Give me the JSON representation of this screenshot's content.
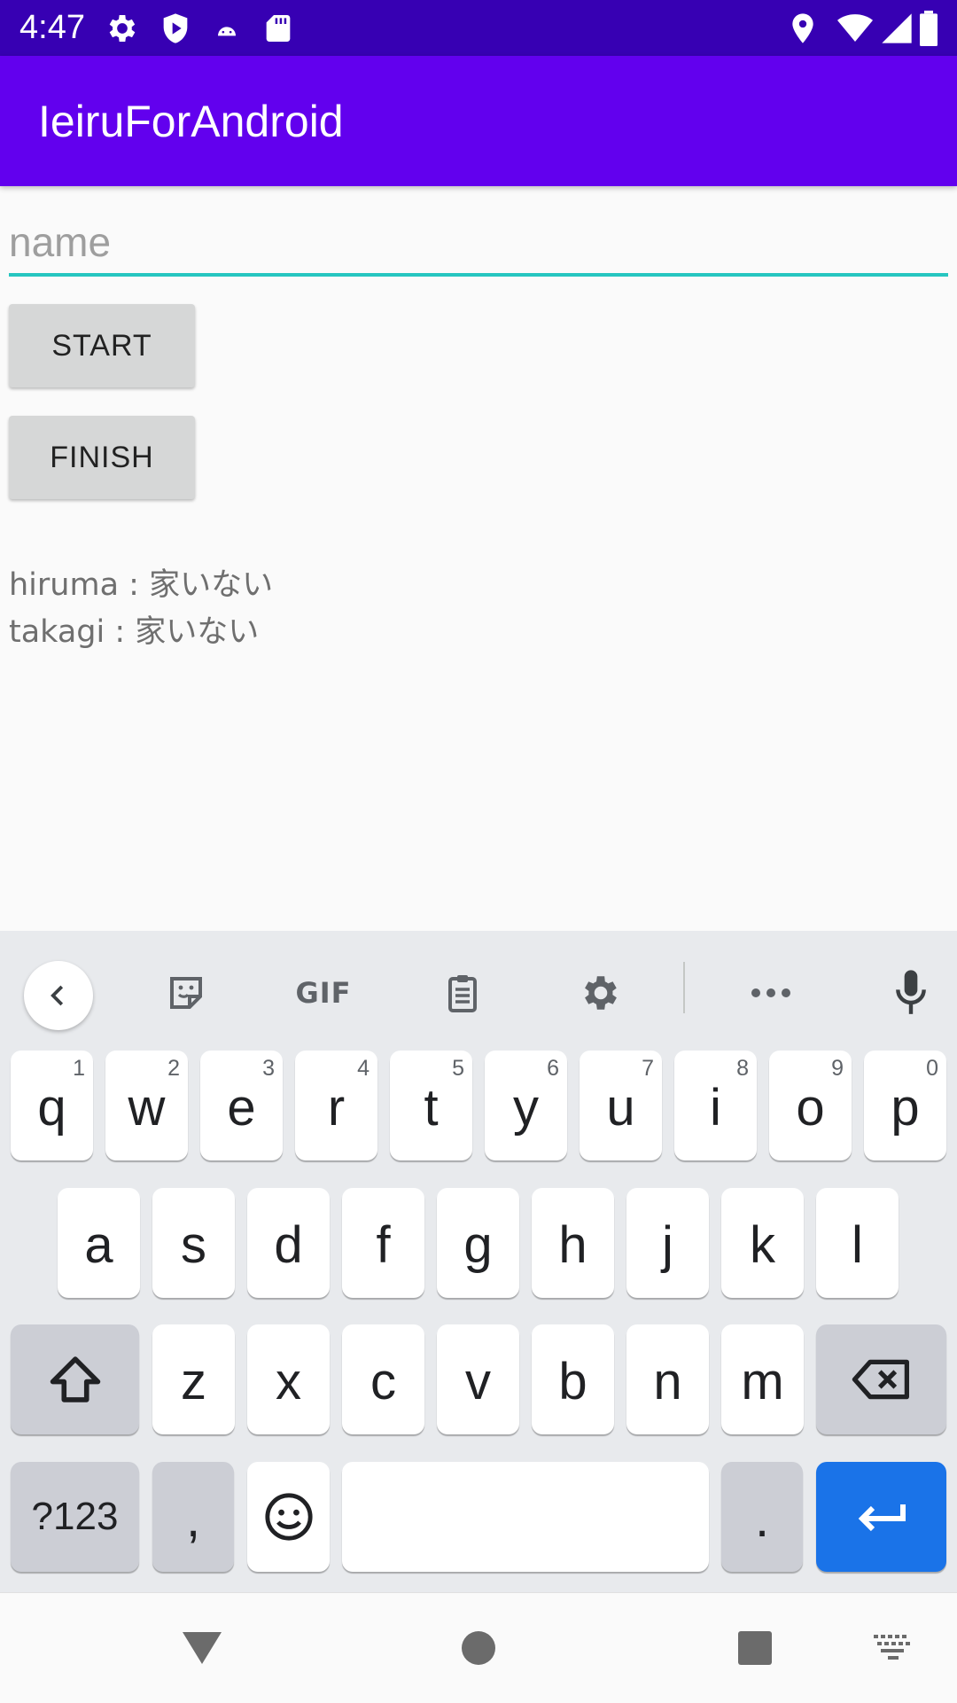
{
  "status_bar": {
    "time": "4:47",
    "left_icons": [
      "settings-icon",
      "shield-icon",
      "android-icon",
      "sd-card-icon"
    ],
    "right_icons": [
      "location-icon",
      "wifi-icon",
      "signal-icon",
      "battery-icon"
    ]
  },
  "app_bar": {
    "title": "IeiruForAndroid",
    "color": "#6200ee"
  },
  "form": {
    "name_placeholder": "name",
    "name_value": "",
    "start_label": "START",
    "finish_label": "FINISH"
  },
  "statuses": [
    {
      "text": "hiruma : 家いない"
    },
    {
      "text": "takagi : 家いない"
    }
  ],
  "keyboard": {
    "toolbar": {
      "items": [
        "back-arrow-icon",
        "sticker-icon",
        "gif-icon",
        "clipboard-icon",
        "settings-icon",
        "more-icon",
        "microphone-icon"
      ],
      "gif_label": "GIF"
    },
    "row1": [
      {
        "label": "q",
        "hint": "1"
      },
      {
        "label": "w",
        "hint": "2"
      },
      {
        "label": "e",
        "hint": "3"
      },
      {
        "label": "r",
        "hint": "4"
      },
      {
        "label": "t",
        "hint": "5"
      },
      {
        "label": "y",
        "hint": "6"
      },
      {
        "label": "u",
        "hint": "7"
      },
      {
        "label": "i",
        "hint": "8"
      },
      {
        "label": "o",
        "hint": "9"
      },
      {
        "label": "p",
        "hint": "0"
      }
    ],
    "row2": [
      {
        "label": "a"
      },
      {
        "label": "s"
      },
      {
        "label": "d"
      },
      {
        "label": "f"
      },
      {
        "label": "g"
      },
      {
        "label": "h"
      },
      {
        "label": "j"
      },
      {
        "label": "k"
      },
      {
        "label": "l"
      }
    ],
    "row3": [
      {
        "label": "z"
      },
      {
        "label": "x"
      },
      {
        "label": "c"
      },
      {
        "label": "v"
      },
      {
        "label": "b"
      },
      {
        "label": "n"
      },
      {
        "label": "m"
      }
    ],
    "symbols_label": "?123",
    "comma_label": ",",
    "period_label": ".",
    "enter_color": "#1a73e8"
  },
  "nav_bar": {
    "buttons": [
      "back-triangle-icon",
      "home-circle-icon",
      "recents-square-icon",
      "keyboard-switch-icon"
    ]
  }
}
